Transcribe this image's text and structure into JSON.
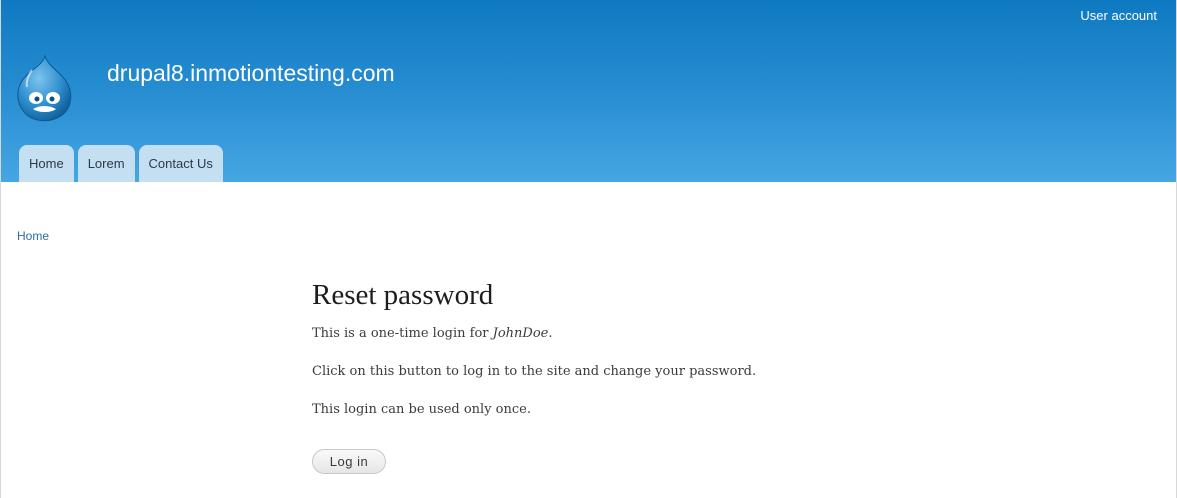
{
  "header": {
    "user_account": "User account",
    "site_name": "drupal8.inmotiontesting.com",
    "logo_icon": "drupal-drop-icon",
    "tabs": [
      {
        "label": "Home"
      },
      {
        "label": "Lorem"
      },
      {
        "label": "Contact Us"
      }
    ],
    "colors": {
      "header_top": "#0e79c1",
      "header_bottom": "#45a6e3",
      "tab_bg": "#c4def2"
    }
  },
  "breadcrumb": {
    "home": "Home"
  },
  "main": {
    "title": "Reset password",
    "line1_prefix": "This is a one-time login for ",
    "line1_user": "JohnDoe",
    "line1_suffix": ".",
    "line2": "Click on this button to log in to the site and change your password.",
    "line3": "This login can be used only once.",
    "login_button": "Log in"
  }
}
